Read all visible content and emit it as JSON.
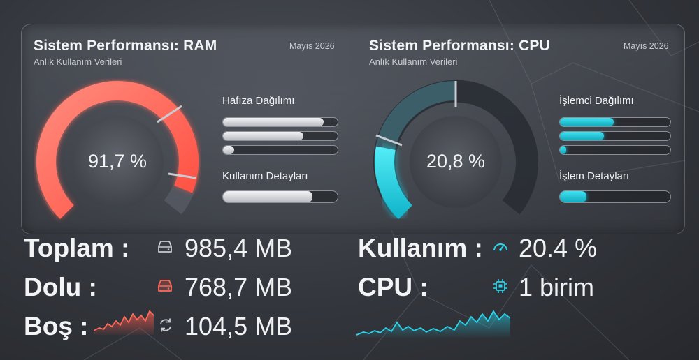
{
  "ram": {
    "title": "Sistem Performansı: RAM",
    "subtitle": "Anlık Kullanım Verileri",
    "date": "Mayıs 2026",
    "gauge_value": "91,7 %",
    "gauge_fraction": 0.917,
    "distribution_heading": "Hafıza Dağılımı",
    "distribution_bars": [
      0.88,
      0.7,
      0.1
    ],
    "detail_heading": "Kullanım Detayları",
    "detail_bar": 0.78,
    "stats": [
      {
        "label": "Toplam :",
        "icon": "hard-drive-icon",
        "value": "985,4 MB"
      },
      {
        "label": "Dolu :",
        "icon": "hard-drive-full-icon",
        "value": "768,7 MB"
      },
      {
        "label": "Boş :",
        "icon": "refresh-icon",
        "value": "104,5 MB"
      }
    ],
    "accent": "#ff5a4c"
  },
  "cpu": {
    "title": "Sistem Performansı: CPU",
    "subtitle": "Anlık Kullanım Verileri",
    "date": "Mayıs 2026",
    "gauge_value": "20,8 %",
    "gauge_fraction": 0.208,
    "distribution_heading": "İşlemci Dağılımı",
    "distribution_bars": [
      0.49,
      0.4,
      0.06
    ],
    "detail_heading": "İşlem Detayları",
    "detail_bar": 0.24,
    "stats": [
      {
        "label": "Kullanım :",
        "icon": "speedometer-icon",
        "value": "20.4 %"
      },
      {
        "label": "CPU :",
        "icon": "cpu-chip-icon",
        "value": "1 birim"
      }
    ],
    "accent": "#22d6ec"
  }
}
